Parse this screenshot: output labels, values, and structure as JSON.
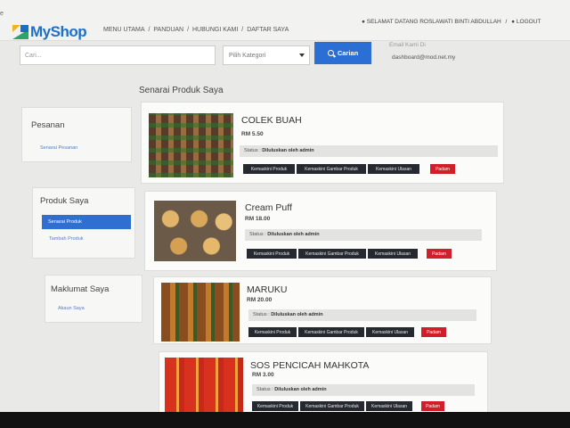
{
  "header": {
    "logo": "MyShop",
    "nav": [
      "MENU UTAMA",
      "PANDUAN",
      "HUBUNGI KAMI",
      "DAFTAR SAYA"
    ],
    "nav_sep": "/",
    "welcome": "SELAMAT DATANG ROSLAWATI BINTI ABDULLAH",
    "logout": "LOGOUT"
  },
  "search": {
    "placeholder": "Cari...",
    "category": "Pilih Kategori",
    "button": "Carian",
    "email_label": "Email Kami Di",
    "email": "dashboard@mod.net.my"
  },
  "page_title": "Senarai Produk Saya",
  "sidebar": {
    "pesanan": {
      "title": "Pesanan",
      "link": "Senarai Pesanan"
    },
    "produk": {
      "title": "Produk Saya",
      "active": "Senarai Produk",
      "link": "Tambah Produk"
    },
    "maklumat": {
      "title": "Maklumat Saya",
      "link": "Akaun Saya"
    }
  },
  "labels": {
    "status_prefix": "Status :",
    "btn_edit": "Kemaskini Produk",
    "btn_image": "Kemaskini Gambar Produk",
    "btn_review": "Kemaskini Ulasan",
    "btn_delete": "Padam"
  },
  "products": [
    {
      "name": "COLEK BUAH",
      "price": "RM 5.50",
      "status": "Diluluskan oleh admin"
    },
    {
      "name": "Cream Puff",
      "price": "RM 18.00",
      "status": "Diluluskan oleh admin"
    },
    {
      "name": "MARUKU",
      "price": "RM 20.00",
      "status": "Diluluskan oleh admin"
    },
    {
      "name": "SOS PENCICAH MAHKOTA",
      "price": "RM 3.00",
      "status": "Diluluskan oleh admin"
    }
  ],
  "colors": {
    "accent": "#2c6fd4",
    "delete": "#d01f2a",
    "button_dark": "#262a30"
  },
  "icons": [
    "myshop-logo-icon",
    "user-icon",
    "lock-icon",
    "search-icon",
    "chevron-down-icon"
  ]
}
